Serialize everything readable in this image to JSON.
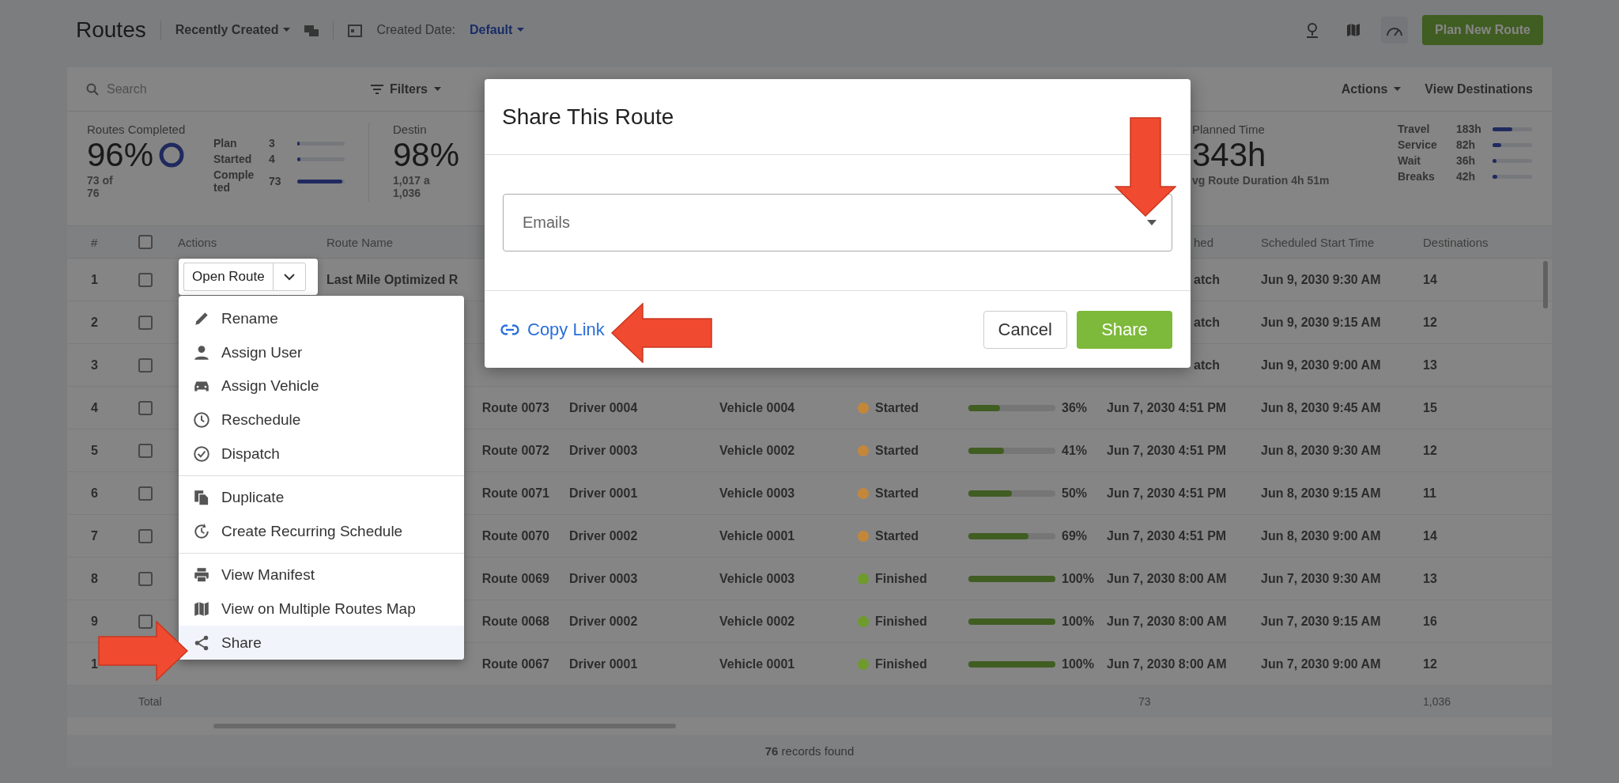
{
  "header": {
    "title": "Routes",
    "sort": "Recently Created",
    "date_label": "Created Date:",
    "date_value": "Default",
    "plan_button": "Plan New Route"
  },
  "toolbar": {
    "search_placeholder": "Search",
    "filters": "Filters",
    "actions": "Actions",
    "view_destinations": "View Destinations"
  },
  "stats": {
    "completed": {
      "title": "Routes Completed",
      "value": "96%",
      "sub": "73 of 76",
      "breakdown": [
        {
          "label": "Plan",
          "count": "3",
          "level": 0.05
        },
        {
          "label": "Started",
          "count": "4",
          "level": 0.07
        },
        {
          "label": "Completed",
          "count": "73",
          "level": 0.95
        }
      ]
    },
    "destinations": {
      "title": "Destin",
      "value": "98%",
      "line_1": "1,017 a",
      "line_2": "1,036"
    },
    "time": {
      "title": "Planned Time",
      "value": "343h",
      "sub": "vg Route Duration 4h 51m",
      "breakdown": [
        {
          "label": "Travel",
          "value": "183h",
          "level": 0.5
        },
        {
          "label": "Service",
          "value": "82h",
          "level": 0.22
        },
        {
          "label": "Wait",
          "value": "36h",
          "level": 0.1
        },
        {
          "label": "Breaks",
          "value": "42h",
          "level": 0.11
        }
      ]
    }
  },
  "table": {
    "header": {
      "number": "#",
      "checked": false,
      "actions": "Actions",
      "route_name": "Route Name",
      "column_9": "hed",
      "scheduled_start": "Scheduled Start Time",
      "destinations": "Destinations"
    },
    "rows": [
      {
        "number": "1",
        "checked": false,
        "route_name": "Last Mile Optimized R",
        "column_9": "atch",
        "scheduled_start": "Jun 9, 2030 9:30 AM",
        "destinations": "14"
      },
      {
        "number": "2",
        "checked": false,
        "column_9": "atch",
        "scheduled_start": "Jun 9, 2030 9:15 AM",
        "destinations": "12"
      },
      {
        "number": "3",
        "checked": false,
        "column_9": "atch",
        "scheduled_start": "Jun 9, 2030 9:00 AM",
        "destinations": "13"
      },
      {
        "number": "4",
        "checked": false,
        "route_name": "Route 0073",
        "driver": "Driver 0004",
        "vehicle": "Vehicle 0004",
        "status": "Started",
        "color": "#c4873a",
        "level": 0.36,
        "progress": "36%",
        "date": "Jun 7, 2030 4:51 PM",
        "scheduled_start": "Jun 8, 2030 9:45 AM",
        "destinations": "15"
      },
      {
        "number": "5",
        "checked": false,
        "route_name": "Route 0072",
        "driver": "Driver 0003",
        "vehicle": "Vehicle 0002",
        "status": "Started",
        "color": "#c4873a",
        "level": 0.41,
        "progress": "41%",
        "date": "Jun 7, 2030 4:51 PM",
        "scheduled_start": "Jun 8, 2030 9:30 AM",
        "destinations": "12"
      },
      {
        "number": "6",
        "checked": false,
        "route_name": "Route 0071",
        "driver": "Driver 0001",
        "vehicle": "Vehicle 0003",
        "status": "Started",
        "color": "#c4873a",
        "level": 0.5,
        "progress": "50%",
        "date": "Jun 7, 2030 4:51 PM",
        "scheduled_start": "Jun 8, 2030 9:15 AM",
        "destinations": "11"
      },
      {
        "number": "7",
        "checked": false,
        "route_name": "Route 0070",
        "driver": "Driver 0002",
        "vehicle": "Vehicle 0001",
        "status": "Started",
        "color": "#c4873a",
        "level": 0.69,
        "progress": "69%",
        "date": "Jun 7, 2030 4:51 PM",
        "scheduled_start": "Jun 8, 2030 9:00 AM",
        "destinations": "14"
      },
      {
        "number": "8",
        "checked": false,
        "route_name": "Route 0069",
        "driver": "Driver 0003",
        "vehicle": "Vehicle 0003",
        "status": "Finished",
        "color": "#6f9a2c",
        "level": 1,
        "progress": "100%",
        "date": "Jun 7, 2030 8:00 AM",
        "scheduled_start": "Jun 7, 2030 9:30 AM",
        "destinations": "13"
      },
      {
        "number": "9",
        "checked": false,
        "route_name": "Route 0068",
        "driver": "Driver 0002",
        "vehicle": "Vehicle 0002",
        "status": "Finished",
        "color": "#6f9a2c",
        "level": 1,
        "progress": "100%",
        "date": "Jun 7, 2030 8:00 AM",
        "scheduled_start": "Jun 7, 2030 9:15 AM",
        "destinations": "16"
      },
      {
        "number": "1",
        "route_name": "Route 0067",
        "driver": "Driver 0001",
        "vehicle": "Vehicle 0001",
        "status": "Finished",
        "color": "#6f9a2c",
        "level": 1,
        "progress": "100%",
        "date": "Jun 7, 2030 8:00 AM",
        "scheduled_start": "Jun 7, 2030 9:00 AM",
        "destinations": "12"
      }
    ],
    "total": {
      "label": "Total",
      "column_9": "73",
      "destinations": "1,036"
    },
    "footer": "**76** records found"
  },
  "row_actions": {
    "open_button": "Open Route",
    "menu": [
      {
        "items": [
          {
            "label": "Rename",
            "selected": false
          },
          {
            "label": "Assign User",
            "selected": false
          },
          {
            "label": "Assign Vehicle",
            "selected": false
          },
          {
            "label": "Reschedule",
            "selected": false
          },
          {
            "label": "Dispatch",
            "selected": false
          }
        ]
      },
      {
        "items": [
          {
            "label": "Duplicate",
            "selected": false
          },
          {
            "label": "Create Recurring Schedule",
            "selected": false
          }
        ]
      },
      {
        "items": [
          {
            "label": "View Manifest",
            "selected": false
          },
          {
            "label": "View on Multiple Routes Map",
            "selected": false
          },
          {
            "label": "Share",
            "selected": true
          }
        ]
      }
    ]
  },
  "modal": {
    "title": "Share This Route",
    "emails_placeholder": "Emails",
    "copy_link": "Copy Link",
    "cancel": "Cancel",
    "share": "Share"
  }
}
